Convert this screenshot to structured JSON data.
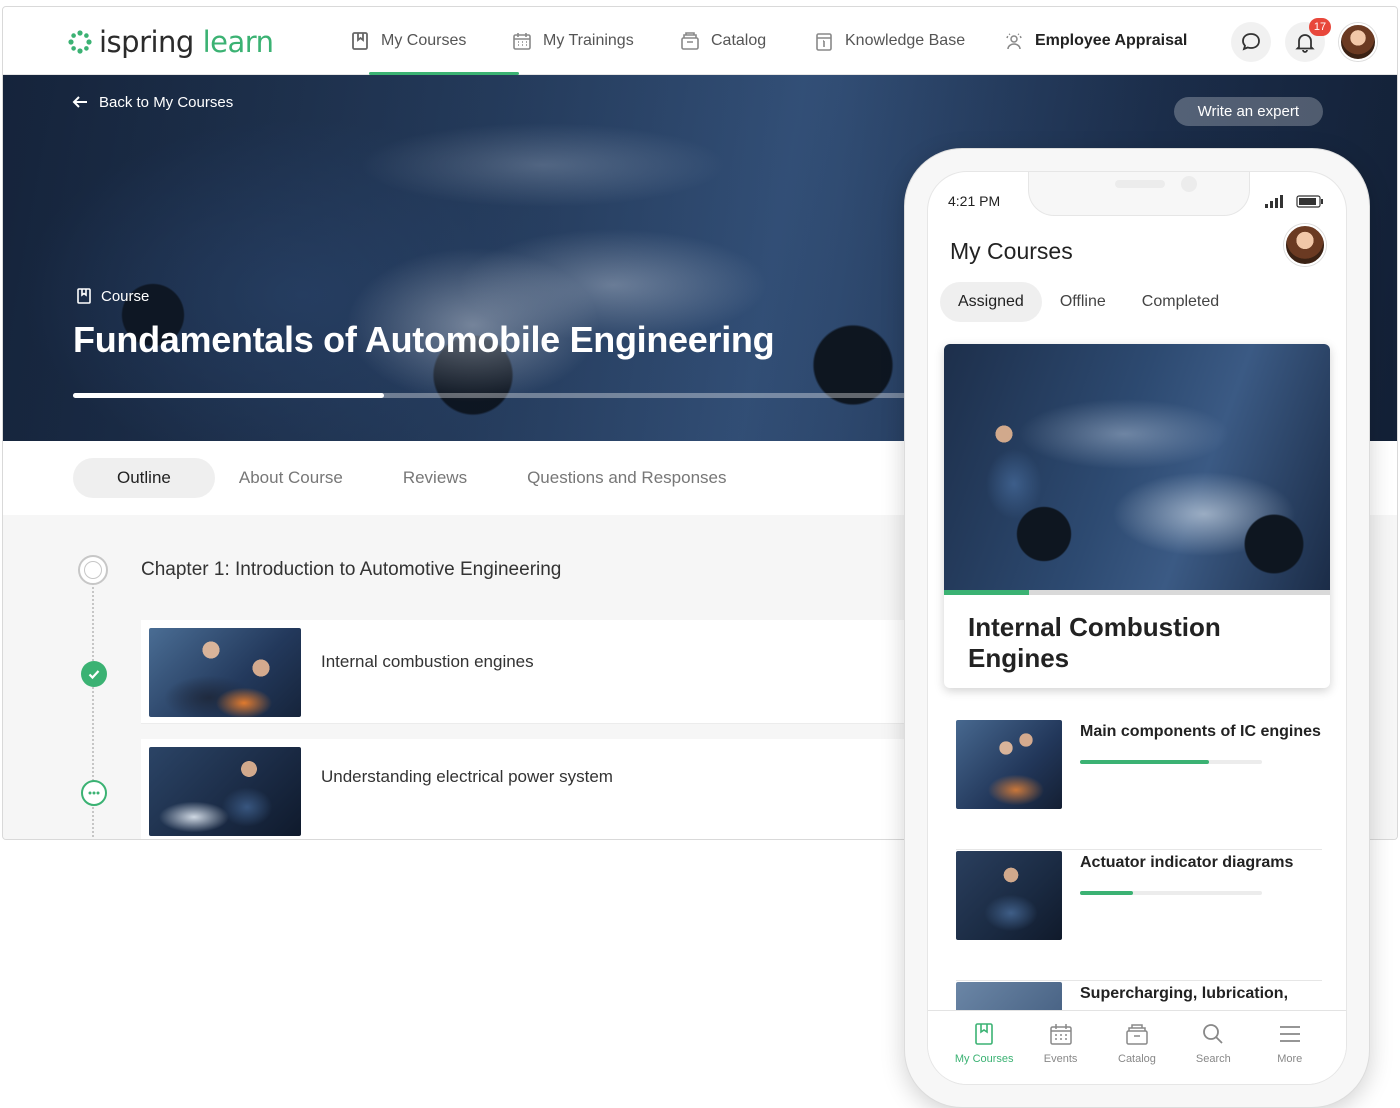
{
  "app": {
    "logo_part1": "ispring",
    "logo_part2": "learn",
    "brand_color": "#3bb273"
  },
  "nav": {
    "items": [
      {
        "label": "My Courses",
        "icon": "book-icon",
        "active": true
      },
      {
        "label": "My Trainings",
        "icon": "calendar-icon"
      },
      {
        "label": "Catalog",
        "icon": "catalog-icon"
      },
      {
        "label": "Knowledge Base",
        "icon": "knowledge-base-icon"
      },
      {
        "label": "Employee Appraisal",
        "icon": "appraisal-icon"
      }
    ],
    "notifications_count": "17"
  },
  "hero": {
    "back_label": "Back to My Courses",
    "write_expert_label": "Write an expert",
    "course_tag": "Course",
    "course_title": "Fundamentals of Automobile Engineering",
    "progress_fraction": 0.37
  },
  "tabs": [
    "Outline",
    "About Course",
    "Reviews",
    "Questions and Responses"
  ],
  "outline": {
    "chapter_title": "Chapter 1: Introduction to Automotive Engineering",
    "lessons": [
      {
        "title": "Internal combustion engines",
        "status": "completed"
      },
      {
        "title": "Understanding electrical power system",
        "status": "in-progress"
      }
    ]
  },
  "phone": {
    "time": "4:21 PM",
    "title": "My Courses",
    "tabs": [
      "Assigned",
      "Offline",
      "Completed"
    ],
    "featured": {
      "title": "Internal Combustion Engines",
      "progress_fraction": 0.22
    },
    "list": [
      {
        "title": "Main components of IC engines",
        "progress_fraction": 0.71
      },
      {
        "title": "Actuator indicator diagrams",
        "progress_fraction": 0.29
      },
      {
        "title": "Supercharging, lubrication,",
        "progress_fraction": 0
      }
    ],
    "bottom_nav": [
      {
        "label": "My Courses",
        "icon": "book-icon",
        "active": true
      },
      {
        "label": "Events",
        "icon": "calendar-icon"
      },
      {
        "label": "Catalog",
        "icon": "catalog-icon"
      },
      {
        "label": "Search",
        "icon": "search-icon"
      },
      {
        "label": "More",
        "icon": "menu-icon"
      }
    ]
  }
}
